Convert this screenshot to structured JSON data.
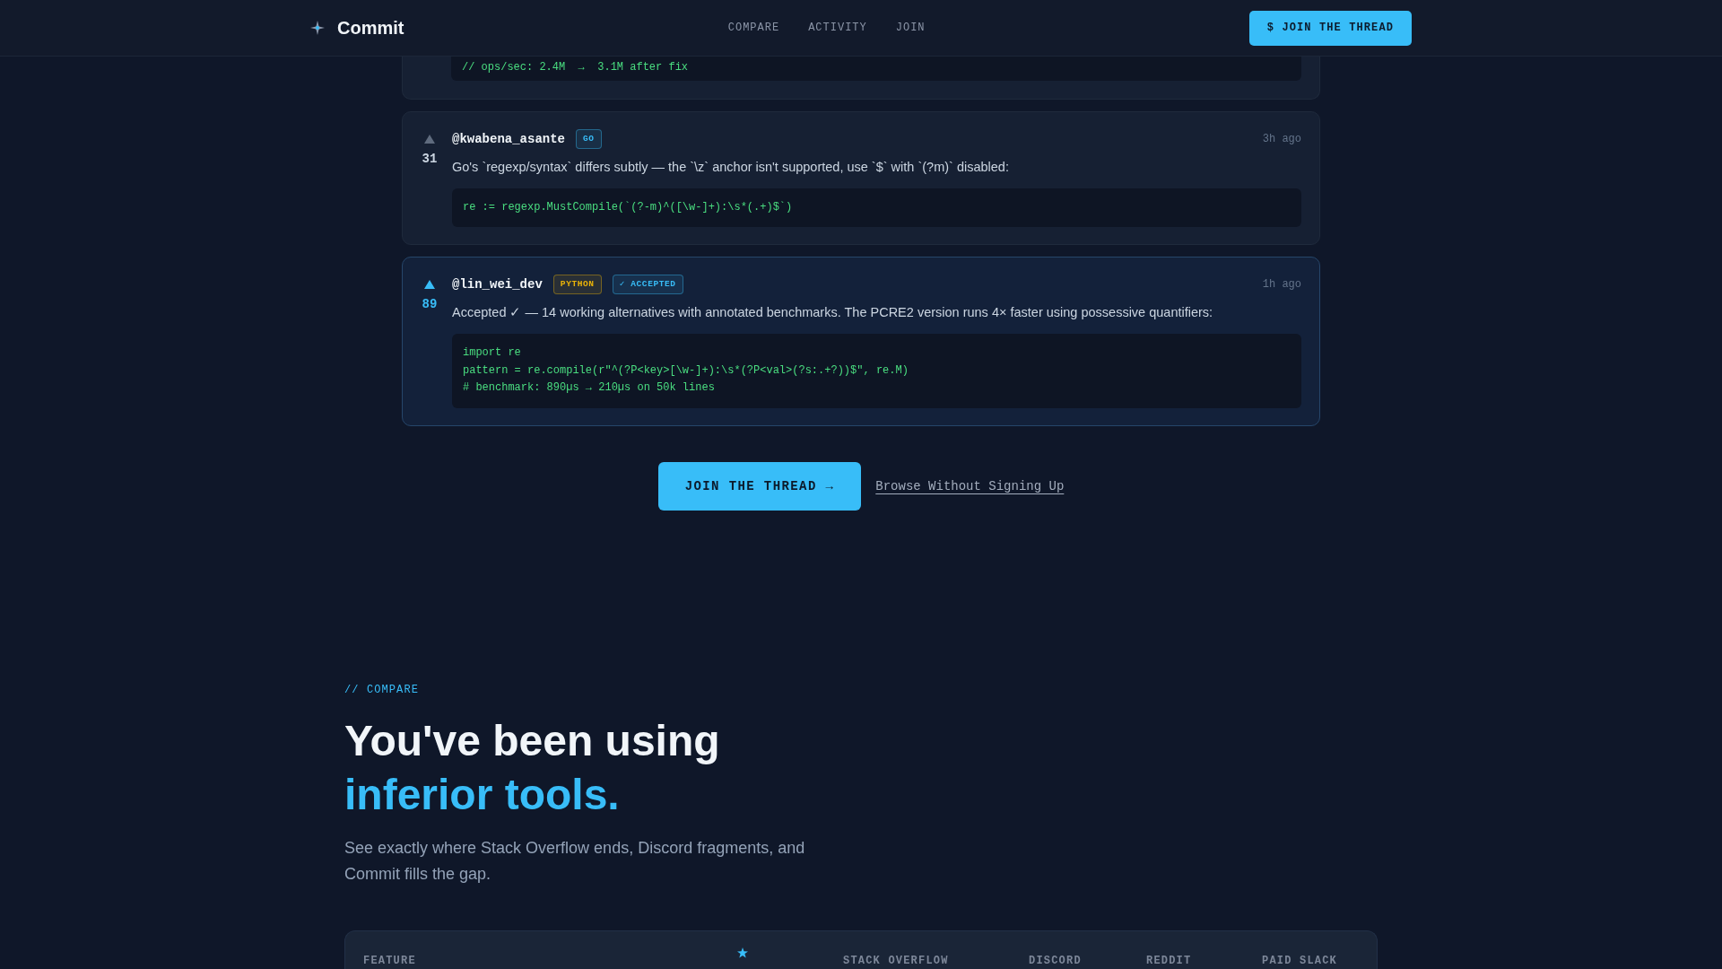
{
  "header": {
    "brand": "Commit",
    "nav": [
      {
        "label": "COMPARE"
      },
      {
        "label": "ACTIVITY"
      },
      {
        "label": "JOIN"
      }
    ],
    "cta": "$ JOIN THE THREAD"
  },
  "partial_answer": {
    "code": [
      "// ops/sec: 2.4M  →  3.1M after fix"
    ]
  },
  "answers": [
    {
      "user": "@kwabena_asante",
      "tags": [
        {
          "label": "GO",
          "color": "#38bdf8"
        }
      ],
      "time": "3h ago",
      "text": "Go's `regexp/syntax` differs subtly — the `\\z` anchor isn't supported, use `$` with `(?m)` disabled:",
      "code": [
        "re := regexp.MustCompile(`(?-m)^([\\w-]+):\\s*(.+)$`)"
      ],
      "votes": "31",
      "upvoted": false,
      "accepted": false
    },
    {
      "user": "@lin_wei_dev",
      "tags": [
        {
          "label": "PYTHON",
          "color": "#eab308"
        },
        {
          "label": "✓ ACCEPTED",
          "color": "#38bdf8"
        }
      ],
      "time": "1h ago",
      "text": "Accepted ✓ — 14 working alternatives with annotated benchmarks. The PCRE2 version runs 4× faster using possessive quantifiers:",
      "code": [
        "import re",
        "pattern = re.compile(r\"^(?P<key>[\\w-]+):\\s*(?P<val>(?s:.+?))$\", re.M)",
        "# benchmark: 890µs → 210µs on 50k lines"
      ],
      "votes": "89",
      "upvoted": true,
      "accepted": true
    }
  ],
  "cta": {
    "primary": "JOIN THE THREAD →",
    "secondary": "Browse Without Signing Up"
  },
  "compare": {
    "eyebrow": "// COMPARE",
    "heading": "You've been using",
    "heading_highlight": "inferior tools.",
    "subtitle": "See exactly where Stack Overflow ends, Discord fragments, and Commit fills the gap.",
    "table": {
      "columns": [
        {
          "kind": "text",
          "label": "FEATURE"
        },
        {
          "kind": "star"
        },
        {
          "kind": "text",
          "label": "STACK OVERFLOW"
        },
        {
          "kind": "text",
          "label": "DISCORD"
        },
        {
          "kind": "text",
          "label": "REDDIT"
        },
        {
          "kind": "text",
          "label": "PAID SLACK"
        }
      ]
    }
  }
}
